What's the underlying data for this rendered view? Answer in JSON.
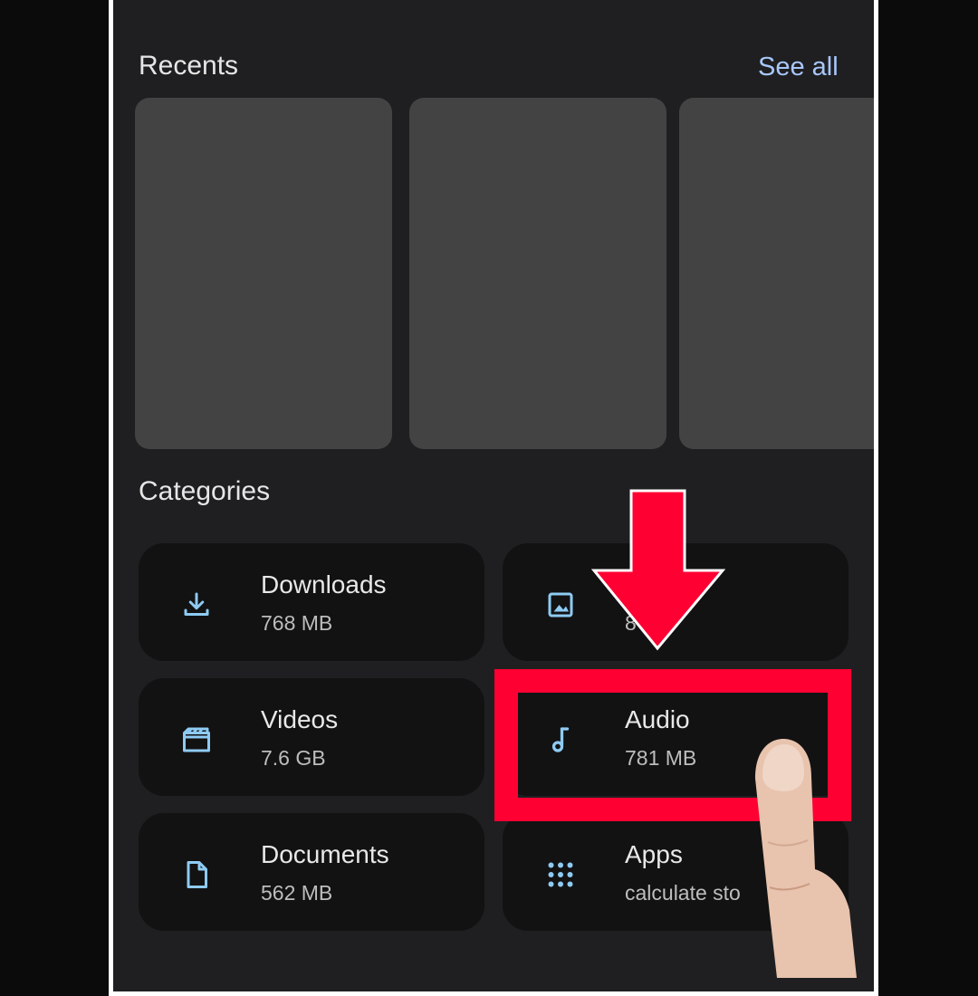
{
  "recents": {
    "title": "Recents",
    "see_all": "See all"
  },
  "categories": {
    "title": "Categories",
    "items": [
      {
        "label": "Downloads",
        "size": "768 MB",
        "icon": "download-icon"
      },
      {
        "label": "Images",
        "size": "8",
        "icon": "image-icon"
      },
      {
        "label": "Videos",
        "size": "7.6 GB",
        "icon": "video-icon"
      },
      {
        "label": "Audio",
        "size": "781 MB",
        "icon": "music-note-icon"
      },
      {
        "label": "Documents",
        "size": "562 MB",
        "icon": "document-icon"
      },
      {
        "label": "Apps",
        "size": "calculate sto",
        "icon": "apps-grid-icon"
      }
    ]
  },
  "colors": {
    "accent": "#a8c7fa",
    "icon": "#8ecbf2",
    "highlight": "#ff0033"
  }
}
